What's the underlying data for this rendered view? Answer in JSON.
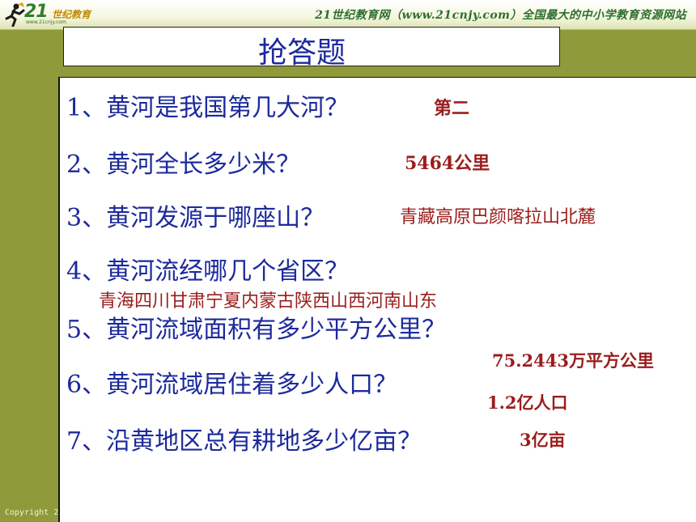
{
  "header": {
    "logo_number": "21",
    "logo_text": "世纪教育",
    "logo_url": "www.21cnjy.com",
    "slogan": "21世纪教育网（www.21cnjy.com）全国最大的中小学教育资源网站"
  },
  "slide": {
    "title": "抢答题",
    "questions": [
      {
        "text": "1、黄河是我国第几大河？",
        "answer": "第二"
      },
      {
        "text": "2、黄河全长多少米？",
        "answer": "5464公里"
      },
      {
        "text": "3、黄河发源于哪座山？",
        "answer": "青藏高原巴颜喀拉山北麓"
      },
      {
        "text": "4、黄河流经哪几个省区？",
        "answer": "青海四川甘肃宁夏内蒙古陕西山西河南山东"
      },
      {
        "text": "5、黄河流域面积有多少平方公里？",
        "answer": "75.2443万平方公里"
      },
      {
        "text": "6、黄河流域居住着多少人口？",
        "answer": "1.2亿人口"
      },
      {
        "text": "7、沿黄地区总有耕地多少亿亩？",
        "answer": "3亿亩"
      }
    ]
  },
  "footer": {
    "copyright": "Copyright 2"
  },
  "colors": {
    "question": "#1c2a9c",
    "answer": "#9b1d1d",
    "background": "#8f9a3a"
  }
}
